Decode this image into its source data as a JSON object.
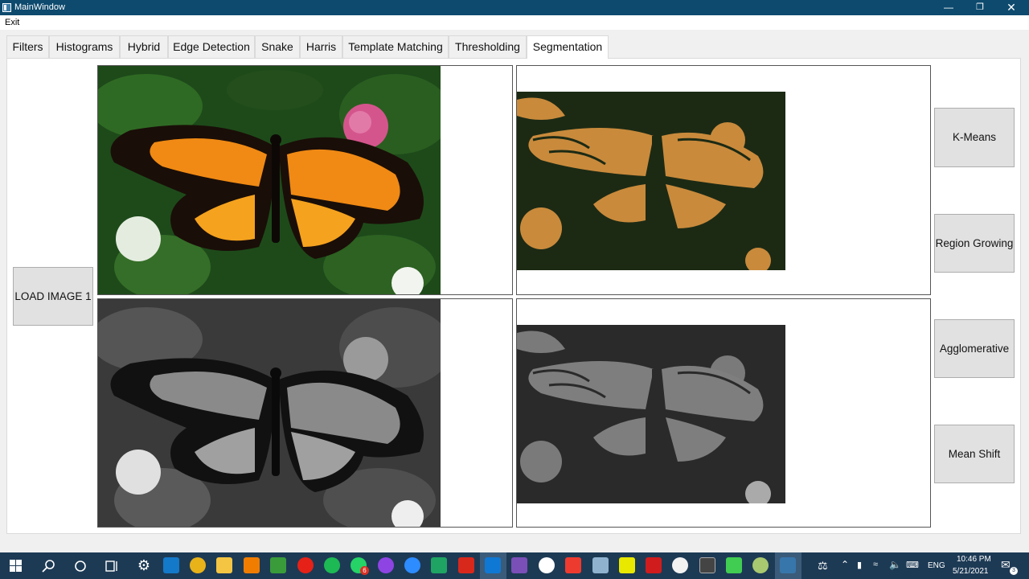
{
  "window": {
    "title": "MainWindow"
  },
  "menu": {
    "exit": "Exit"
  },
  "tabs": [
    {
      "label": "Filters"
    },
    {
      "label": "Histograms"
    },
    {
      "label": "Hybrid"
    },
    {
      "label": "Edge Detection"
    },
    {
      "label": "Snake"
    },
    {
      "label": "Harris"
    },
    {
      "label": "Template Matching"
    },
    {
      "label": "Thresholding"
    },
    {
      "label": "Segmentation"
    }
  ],
  "active_tab": "Segmentation",
  "buttons": {
    "load_image": "LOAD IMAGE 1",
    "kmeans": "K-Means",
    "region_growing": "Region Growing",
    "agglomerative": "Agglomerative",
    "mean_shift": "Mean Shift"
  },
  "colors": {
    "titlebar": "#0d4a6e",
    "butterfly_orange": "#f08a14",
    "segmented_bg": "#1c2a14",
    "segmented_fg": "#c98a3c"
  },
  "taskbar": {
    "lang": "ENG",
    "time": "10:46 PM",
    "date": "5/21/2021",
    "whatsapp_badge": "6",
    "notification_count": "3"
  }
}
